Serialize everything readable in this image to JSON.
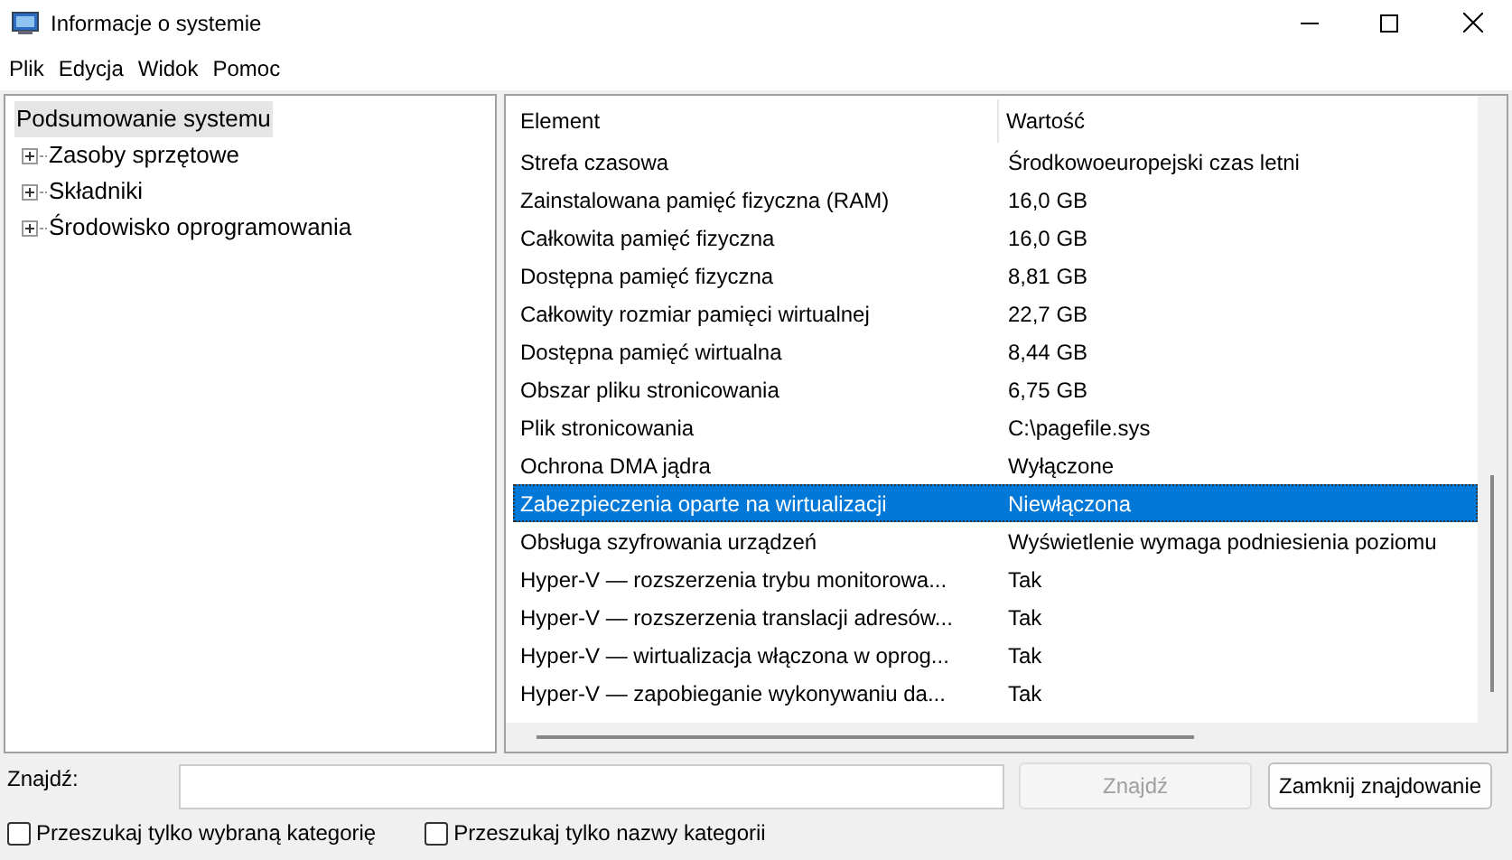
{
  "window": {
    "title": "Informacje o systemie"
  },
  "menu": [
    "Plik",
    "Edycja",
    "Widok",
    "Pomoc"
  ],
  "tree": {
    "label": "Podsumowanie systemu",
    "selected": true,
    "children": [
      {
        "label": "Zasoby sprzętowe",
        "expanded": false
      },
      {
        "label": "Składniki",
        "expanded": false
      },
      {
        "label": "Środowisko oprogramowania",
        "expanded": false
      }
    ]
  },
  "table": {
    "columns": [
      "Element",
      "Wartość"
    ],
    "rows": [
      {
        "cells": [
          "Strefa czasowa",
          "Środkowoeuropejski czas letni"
        ],
        "selected": false
      },
      {
        "cells": [
          "Zainstalowana pamięć fizyczna (RAM)",
          "16,0 GB"
        ],
        "selected": false
      },
      {
        "cells": [
          "Całkowita pamięć fizyczna",
          "16,0 GB"
        ],
        "selected": false
      },
      {
        "cells": [
          "Dostępna pamięć fizyczna",
          "8,81 GB"
        ],
        "selected": false
      },
      {
        "cells": [
          "Całkowity rozmiar pamięci wirtualnej",
          "22,7 GB"
        ],
        "selected": false
      },
      {
        "cells": [
          "Dostępna pamięć wirtualna",
          "8,44 GB"
        ],
        "selected": false
      },
      {
        "cells": [
          "Obszar pliku stronicowania",
          "6,75 GB"
        ],
        "selected": false
      },
      {
        "cells": [
          "Plik stronicowania",
          "C:\\pagefile.sys"
        ],
        "selected": false
      },
      {
        "cells": [
          "Ochrona DMA jądra",
          "Wyłączone"
        ],
        "selected": false
      },
      {
        "cells": [
          "Zabezpieczenia oparte na wirtualizacji",
          "Niewłączona"
        ],
        "selected": true
      },
      {
        "cells": [
          "Obsługa szyfrowania urządzeń",
          "Wyświetlenie wymaga podniesienia poziomu"
        ],
        "selected": false
      },
      {
        "cells": [
          "Hyper-V — rozszerzenia trybu monitorowa...",
          "Tak"
        ],
        "selected": false
      },
      {
        "cells": [
          "Hyper-V — rozszerzenia translacji adresów...",
          "Tak"
        ],
        "selected": false
      },
      {
        "cells": [
          "Hyper-V — wirtualizacja włączona w oprog...",
          "Tak"
        ],
        "selected": false
      },
      {
        "cells": [
          "Hyper-V — zapobieganie wykonywaniu da...",
          "Tak"
        ],
        "selected": false
      }
    ]
  },
  "find": {
    "label": "Znajdź:",
    "find_button": {
      "label": "Znajdź",
      "disabled": true
    },
    "close_button": {
      "label": "Zamknij znajdowanie",
      "disabled": false
    }
  },
  "options": [
    {
      "label": "Przeszukaj tylko wybraną kategorię",
      "checked": false
    },
    {
      "label": "Przeszukaj tylko nazwy kategorii",
      "checked": false
    }
  ]
}
